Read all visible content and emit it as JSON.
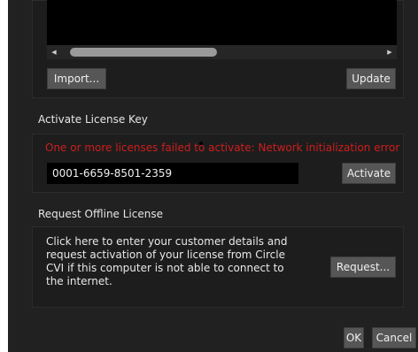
{
  "import_section": {
    "import_button": "Import...",
    "update_button": "Update"
  },
  "activate_section": {
    "title": "Activate License Key",
    "error_message": "One or more licenses failed to activate: Network initialization error",
    "license_key": "0001-6659-8501-2359",
    "activate_button": "Activate"
  },
  "offline_section": {
    "title": "Request Offline License",
    "description": "Click here to enter your customer details and request activation of your license from Circle CVI if this computer is not able to connect to the internet.",
    "request_button": "Request..."
  },
  "footer": {
    "ok_button": "OK",
    "cancel_button": "Cancel"
  },
  "colors": {
    "background": "#212121",
    "error": "#d01d1d",
    "button": "#565656"
  }
}
